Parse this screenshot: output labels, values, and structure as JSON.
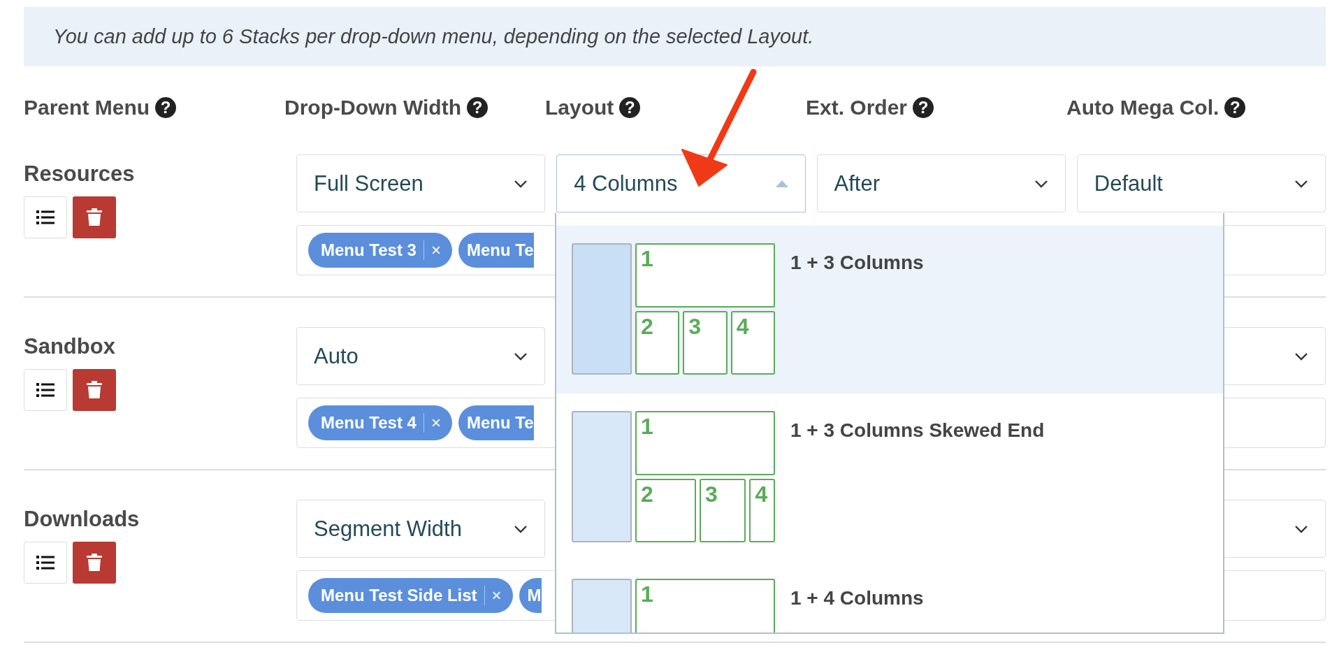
{
  "notice": "You can add up to 6 Stacks per drop-down menu, depending on the selected Layout.",
  "columns": [
    {
      "label": "Parent Menu",
      "help": "?"
    },
    {
      "label": "Drop-Down Width",
      "help": "?"
    },
    {
      "label": "Layout",
      "help": "?"
    },
    {
      "label": "Ext. Order",
      "help": "?"
    },
    {
      "label": "Auto Mega Col.",
      "help": "?"
    }
  ],
  "rows": [
    {
      "name": "Resources",
      "selects": [
        {
          "value": "Full Screen",
          "open": false
        },
        {
          "value": "4 Columns",
          "open": true
        },
        {
          "value": "After",
          "open": false
        },
        {
          "value": "Default",
          "open": false
        }
      ],
      "chips": [
        {
          "label": "Menu Test 3",
          "remove": "×"
        },
        {
          "label": "Menu Te"
        }
      ]
    },
    {
      "name": "Sandbox",
      "selects": [
        {
          "value": "Auto",
          "open": false
        }
      ],
      "chips": [
        {
          "label": "Menu Test 4",
          "remove": "×"
        },
        {
          "label": "Menu Te"
        }
      ]
    },
    {
      "name": "Downloads",
      "selects": [
        {
          "value": "Segment Width",
          "open": false
        }
      ],
      "chips": [
        {
          "label": "Menu Test Side List",
          "remove": "×"
        },
        {
          "label": "M"
        }
      ]
    }
  ],
  "layout_dropdown": {
    "options": [
      {
        "label": "1 + 3 Columns",
        "selected": true,
        "kind": "even",
        "cells": [
          "1",
          "2",
          "3",
          "4"
        ]
      },
      {
        "label": "1 + 3 Columns Skewed End",
        "selected": false,
        "kind": "skewed",
        "cells": [
          "1",
          "2",
          "3",
          "4"
        ]
      },
      {
        "label": "1 + 4 Columns",
        "selected": false,
        "kind": "even",
        "cells": [
          "1"
        ]
      }
    ]
  }
}
